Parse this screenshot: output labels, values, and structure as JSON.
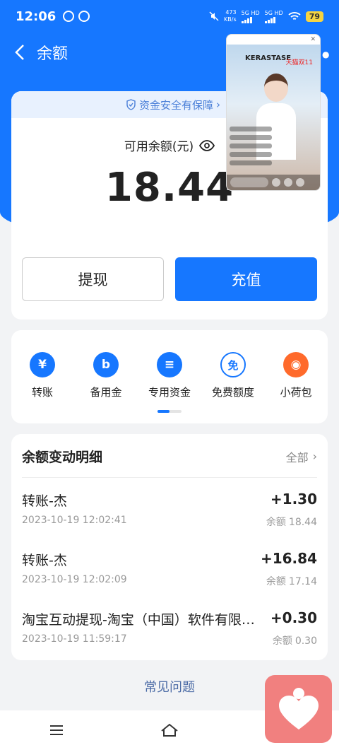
{
  "status_bar": {
    "time": "12:06",
    "net_speed_value": "473",
    "net_speed_unit": "KB/s",
    "sim1": "5G HD",
    "sim2": "5G HD",
    "battery": "79"
  },
  "header": {
    "title": "余额"
  },
  "balance": {
    "safety_text": "资金安全有保障",
    "label": "可用余额(元)",
    "amount": "18.44",
    "withdraw_label": "提现",
    "recharge_label": "充值"
  },
  "float_video": {
    "brand": "KERASTASE",
    "badge": "天猫双11",
    "icon": "live-video-icon"
  },
  "quick_actions": [
    {
      "label": "转账",
      "icon": "transfer-icon",
      "glyph": "¥",
      "color": "#1677ff"
    },
    {
      "label": "备用金",
      "icon": "reserve-fund-icon",
      "glyph": "b",
      "color": "#1677ff"
    },
    {
      "label": "专用资金",
      "icon": "dedicated-fund-icon",
      "glyph": "≡",
      "color": "#1677ff"
    },
    {
      "label": "免费额度",
      "icon": "free-quota-icon",
      "glyph": "免",
      "color": "#1677ff"
    },
    {
      "label": "小荷包",
      "icon": "small-purse-icon",
      "glyph": "◉",
      "color": "#ff6a2b"
    }
  ],
  "transactions": {
    "title": "余额变动明细",
    "all_label": "全部",
    "balance_prefix": "余额",
    "items": [
      {
        "name": "转账-杰",
        "amount": "+1.30",
        "time": "2023-10-19 12:02:41",
        "balance": "18.44"
      },
      {
        "name": "转账-杰",
        "amount": "+16.84",
        "time": "2023-10-19 12:02:09",
        "balance": "17.14"
      },
      {
        "name": "淘宝互动提现-淘宝（中国）软件有限公司",
        "amount": "+0.30",
        "time": "2023-10-19 11:59:17",
        "balance": "0.30"
      }
    ]
  },
  "faq_label": "常见问题",
  "colors": {
    "primary": "#1677ff",
    "heart_fab": "#f1807f"
  }
}
